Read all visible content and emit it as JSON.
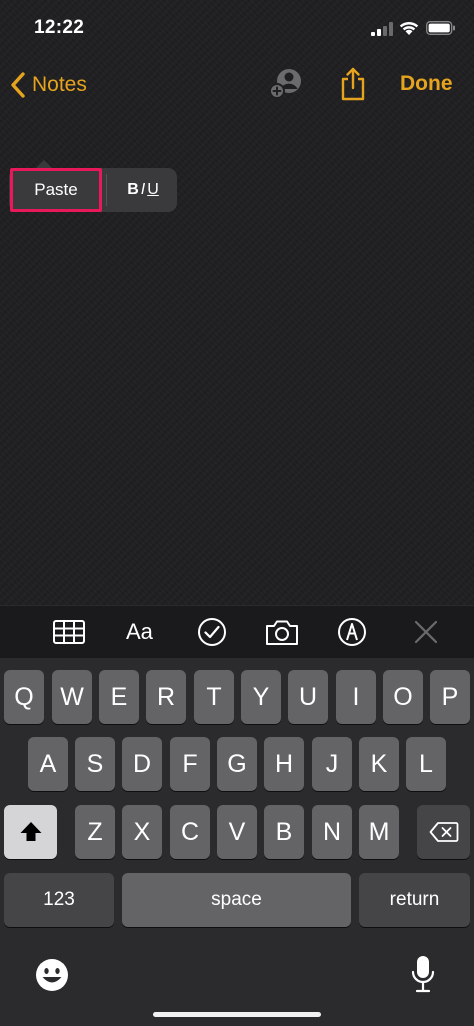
{
  "status_bar": {
    "time": "12:22",
    "signal_icon": "cellular-signal-icon",
    "wifi_icon": "wifi-icon",
    "battery_icon": "battery-icon"
  },
  "nav": {
    "back_label": "Notes",
    "done_label": "Done",
    "accent_color": "#e6a31e",
    "icons": [
      "chevron-left-icon",
      "add-person-icon",
      "share-icon"
    ]
  },
  "edit_menu": {
    "paste_label": "Paste",
    "bold_label": "B",
    "italic_label": "I",
    "underline_label": "U",
    "highlight_color": "#e8185a"
  },
  "format_toolbar": {
    "text_style_label": "Aa",
    "icons": [
      "table-icon",
      "text-format-icon",
      "checklist-icon",
      "camera-icon",
      "markup-icon",
      "close-icon"
    ]
  },
  "keyboard": {
    "row1": [
      "Q",
      "W",
      "E",
      "R",
      "T",
      "Y",
      "U",
      "I",
      "O",
      "P"
    ],
    "row2": [
      "A",
      "S",
      "D",
      "F",
      "G",
      "H",
      "J",
      "K",
      "L"
    ],
    "row3": [
      "Z",
      "X",
      "C",
      "V",
      "B",
      "N",
      "M"
    ],
    "numbers_label": "123",
    "space_label": "space",
    "return_label": "return",
    "icons": [
      "shift-icon",
      "delete-icon",
      "emoji-icon",
      "microphone-icon"
    ]
  }
}
